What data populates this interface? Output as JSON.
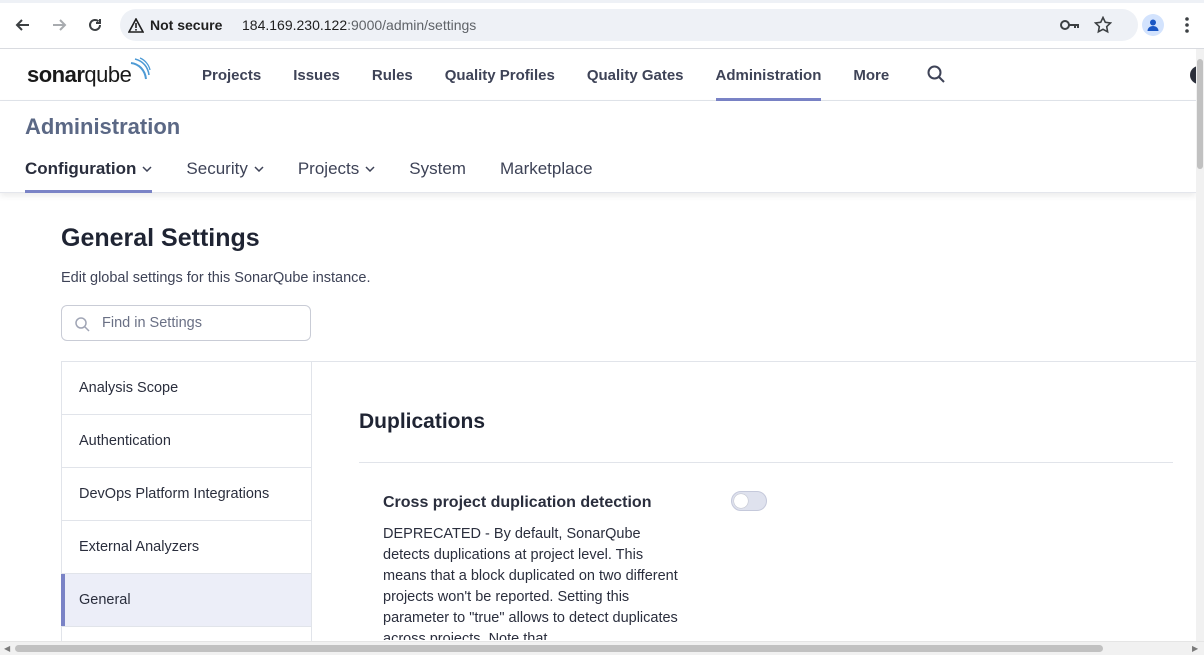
{
  "browser": {
    "security_label": "Not secure",
    "url_host": "184.169.230.122",
    "url_rest": ":9000/admin/settings"
  },
  "topnav": {
    "logo_bold": "sonar",
    "logo_light": "qube",
    "items": [
      {
        "label": "Projects"
      },
      {
        "label": "Issues"
      },
      {
        "label": "Rules"
      },
      {
        "label": "Quality Profiles"
      },
      {
        "label": "Quality Gates"
      },
      {
        "label": "Administration"
      },
      {
        "label": "More"
      }
    ]
  },
  "admin": {
    "title": "Administration",
    "tabs": [
      {
        "label": "Configuration"
      },
      {
        "label": "Security"
      },
      {
        "label": "Projects"
      },
      {
        "label": "System"
      },
      {
        "label": "Marketplace"
      }
    ]
  },
  "settings": {
    "title": "General Settings",
    "description": "Edit global settings for this SonarQube instance.",
    "search_placeholder": "Find in Settings",
    "categories": [
      {
        "label": "Analysis Scope"
      },
      {
        "label": "Authentication"
      },
      {
        "label": "DevOps Platform Integrations"
      },
      {
        "label": "External Analyzers"
      },
      {
        "label": "General"
      }
    ],
    "section_title": "Duplications",
    "setting": {
      "name": "Cross project duplication detection",
      "description": "DEPRECATED - By default, SonarQube detects duplications at project level. This means that a block duplicated on two different projects won't be reported. Setting this parameter to \"true\" allows to detect duplicates across projects. Note that",
      "enabled": false
    }
  },
  "colors": {
    "accent": "#7a83c6",
    "admin_title": "#5b6885"
  }
}
